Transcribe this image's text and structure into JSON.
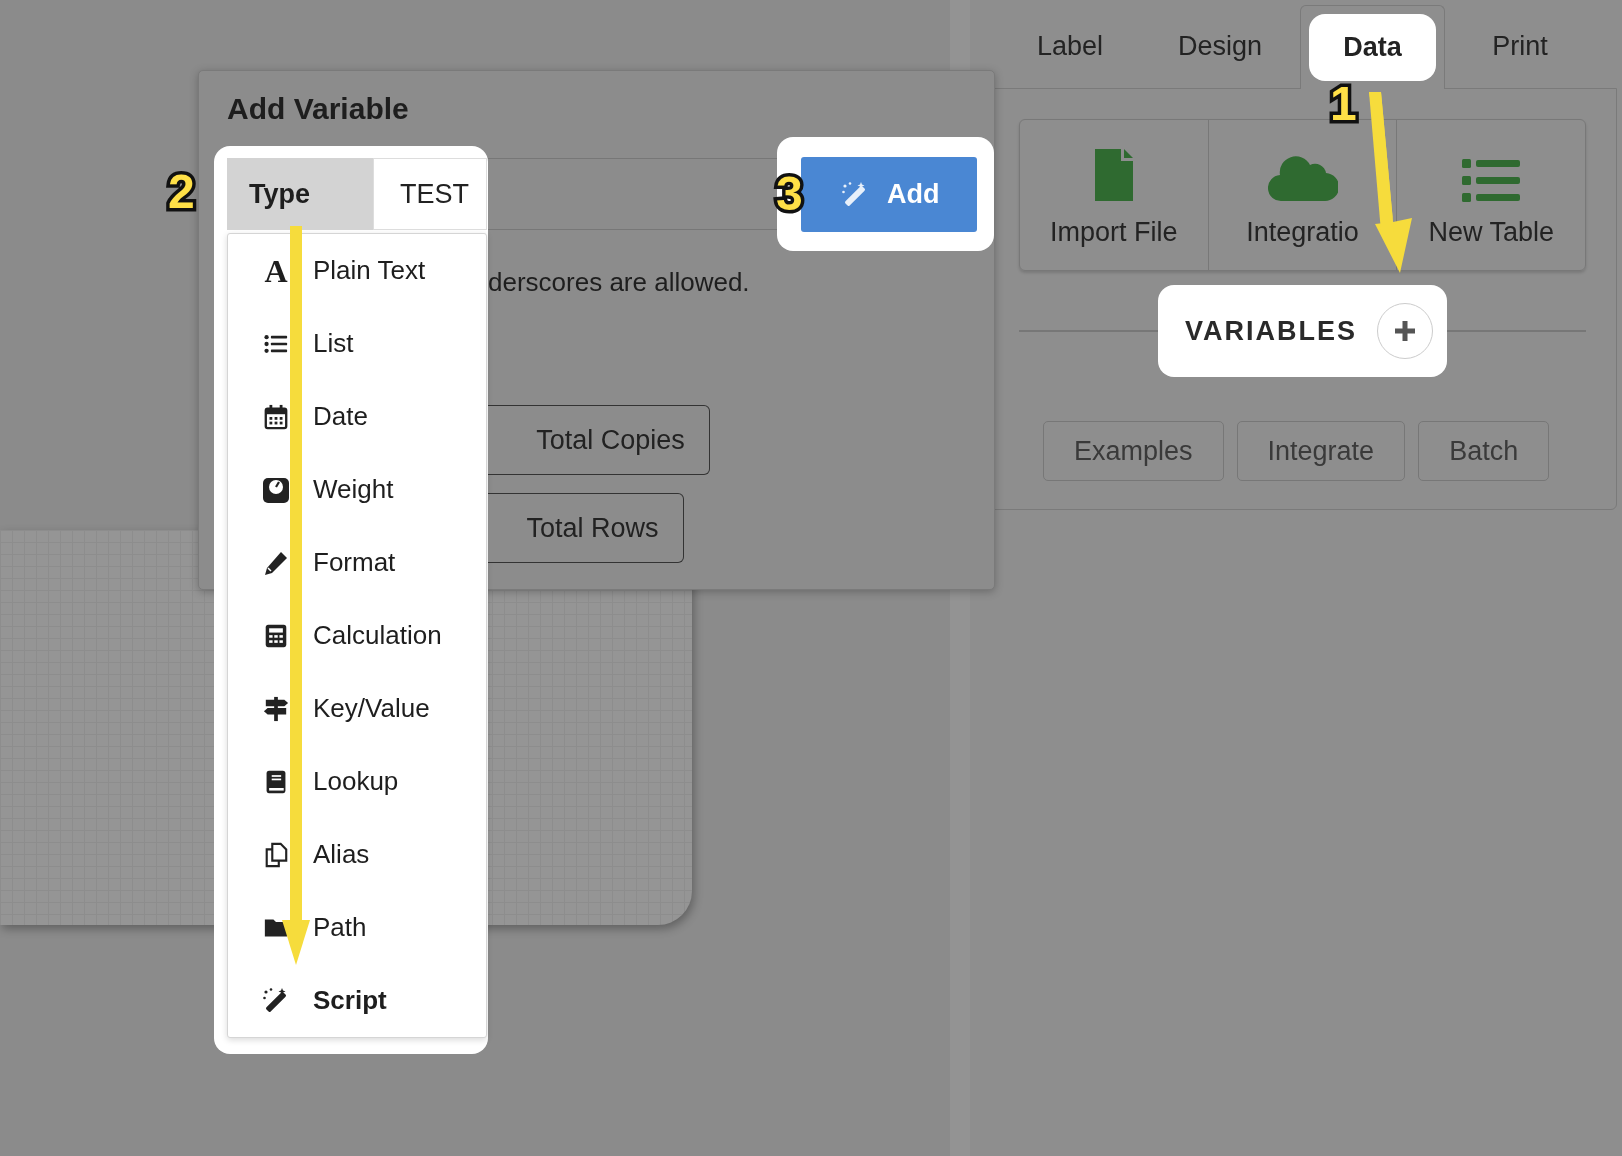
{
  "tabs": [
    {
      "label": "Label",
      "selected": false,
      "highlighted": false
    },
    {
      "label": "Design",
      "selected": false,
      "highlighted": false
    },
    {
      "label": "Data",
      "selected": true,
      "highlighted": true
    },
    {
      "label": "Print",
      "selected": false,
      "highlighted": false
    }
  ],
  "data_sources": [
    {
      "label": "Import File",
      "kind": "file"
    },
    {
      "label": "Integratio",
      "kind": "cloud"
    },
    {
      "label": "New Table",
      "kind": "table"
    }
  ],
  "variables": {
    "label": "VARIABLES",
    "highlighted": true
  },
  "actions": [
    "Examples",
    "Integrate",
    "Batch"
  ],
  "dialog": {
    "title": "Add Variable",
    "type_selector": {
      "label": "Type",
      "value": "TEST",
      "highlighted": true,
      "open": true
    },
    "add_button": {
      "label": "Add",
      "highlighted": true
    },
    "hint": "derscores are allowed.",
    "buttons": [
      "Total Copies",
      "Total Rows"
    ],
    "type_menu": [
      {
        "label": "Plain Text",
        "kind": "text",
        "icon": "A",
        "selected": false
      },
      {
        "label": "List",
        "kind": "list",
        "selected": false
      },
      {
        "label": "Date",
        "kind": "date",
        "selected": false
      },
      {
        "label": "Weight",
        "kind": "weight",
        "selected": false
      },
      {
        "label": "Format",
        "kind": "format",
        "selected": false
      },
      {
        "label": "Calculation",
        "kind": "calculation",
        "selected": false
      },
      {
        "label": "Key/Value",
        "kind": "keyvalue",
        "selected": false
      },
      {
        "label": "Lookup",
        "kind": "lookup",
        "selected": false
      },
      {
        "label": "Alias",
        "kind": "alias",
        "selected": false
      },
      {
        "label": "Path",
        "kind": "path",
        "selected": false
      },
      {
        "label": "Script",
        "kind": "script",
        "selected": true
      }
    ]
  },
  "annotations": [
    {
      "number": "1"
    },
    {
      "number": "2"
    },
    {
      "number": "3"
    }
  ]
}
